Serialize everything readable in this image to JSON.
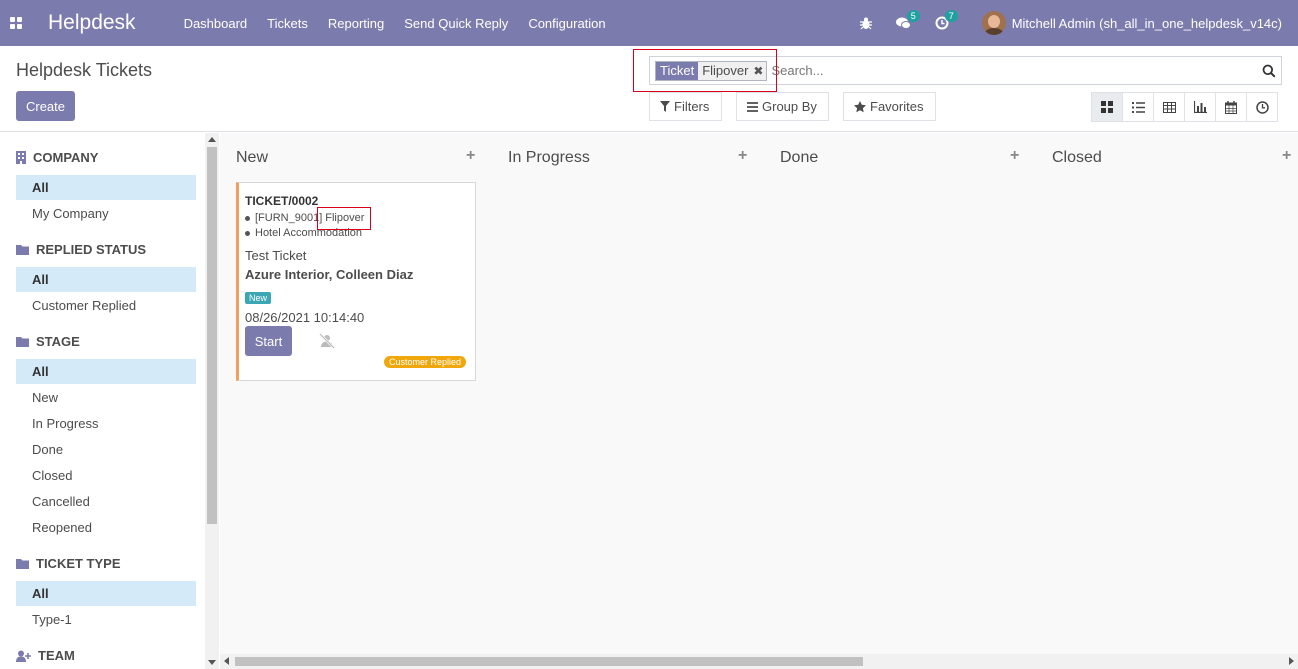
{
  "navbar": {
    "app_name": "Helpdesk",
    "menu": [
      "Dashboard",
      "Tickets",
      "Reporting",
      "Send Quick Reply",
      "Configuration"
    ],
    "messages_count": "5",
    "activities_count": "7",
    "user_name": "Mitchell Admin (sh_all_in_one_helpdesk_v14c)"
  },
  "control_panel": {
    "title": "Helpdesk Tickets",
    "create_label": "Create",
    "search": {
      "facet_label": "Ticket",
      "facet_value": "Flipover",
      "placeholder": "Search..."
    },
    "filters_label": "Filters",
    "group_by_label": "Group By",
    "favorites_label": "Favorites",
    "views": [
      "kanban",
      "list",
      "pivot",
      "graph",
      "calendar",
      "activity"
    ],
    "active_view": "kanban"
  },
  "sidebar": {
    "groups": [
      {
        "title": "COMPANY",
        "icon": "building-icon",
        "items": [
          "All",
          "My Company"
        ]
      },
      {
        "title": "REPLIED STATUS",
        "icon": "folder-icon",
        "items": [
          "All",
          "Customer Replied"
        ]
      },
      {
        "title": "STAGE",
        "icon": "folder-icon",
        "items": [
          "All",
          "New",
          "In Progress",
          "Done",
          "Closed",
          "Cancelled",
          "Reopened"
        ]
      },
      {
        "title": "TICKET TYPE",
        "icon": "folder-icon",
        "items": [
          "All",
          "Type-1"
        ]
      },
      {
        "title": "TEAM",
        "icon": "user-plus-icon",
        "items": []
      }
    ]
  },
  "kanban": {
    "columns": [
      "New",
      "In Progress",
      "Done",
      "Closed"
    ],
    "card": {
      "reference": "TICKET/0002",
      "product_code": "[FURN_9001]",
      "product_name": "Flipover",
      "category": "Hotel Accommodation",
      "subject": "Test Ticket",
      "partner": "Azure Interior, Colleen Diaz",
      "stage_badge": "New",
      "date": "08/26/2021 10:14:40",
      "start_label": "Start",
      "replied_badge": "Customer Replied"
    }
  },
  "colors": {
    "brand": "#7c7bad",
    "highlight": "#d9001b",
    "card_border": "#f3a05d",
    "stage_badge": "#3ca7b4",
    "replied_badge": "#f0a70b",
    "active_filter": "#d4eaf8"
  }
}
